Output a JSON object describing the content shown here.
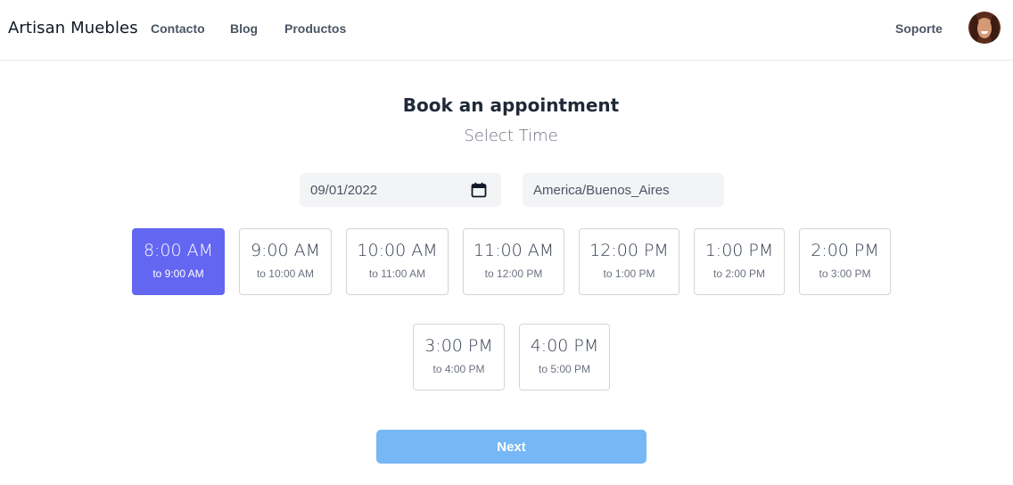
{
  "nav": {
    "brand": "Artisan Muebles",
    "links": [
      "Contacto",
      "Blog",
      "Productos"
    ],
    "support": "Soporte"
  },
  "header": {
    "title": "Book an appointment",
    "subtitle": "Select Time"
  },
  "form": {
    "date_value": "09/01/2022",
    "timezone_value": "America/Buenos_Aires"
  },
  "slots": [
    {
      "start": "8:00 AM",
      "end": "to 9:00 AM",
      "selected": true
    },
    {
      "start": "9:00 AM",
      "end": "to 10:00 AM",
      "selected": false
    },
    {
      "start": "10:00 AM",
      "end": "to 11:00 AM",
      "selected": false
    },
    {
      "start": "11:00 AM",
      "end": "to 12:00 PM",
      "selected": false
    },
    {
      "start": "12:00 PM",
      "end": "to 1:00 PM",
      "selected": false
    },
    {
      "start": "1:00 PM",
      "end": "to 2:00 PM",
      "selected": false
    },
    {
      "start": "2:00 PM",
      "end": "to 3:00 PM",
      "selected": false
    },
    {
      "start": "3:00 PM",
      "end": "to 4:00 PM",
      "selected": false
    },
    {
      "start": "4:00 PM",
      "end": "to 5:00 PM",
      "selected": false
    }
  ],
  "actions": {
    "next_label": "Next"
  },
  "colors": {
    "selected_slot": "#6366f1",
    "next_button": "#76b7f5"
  }
}
